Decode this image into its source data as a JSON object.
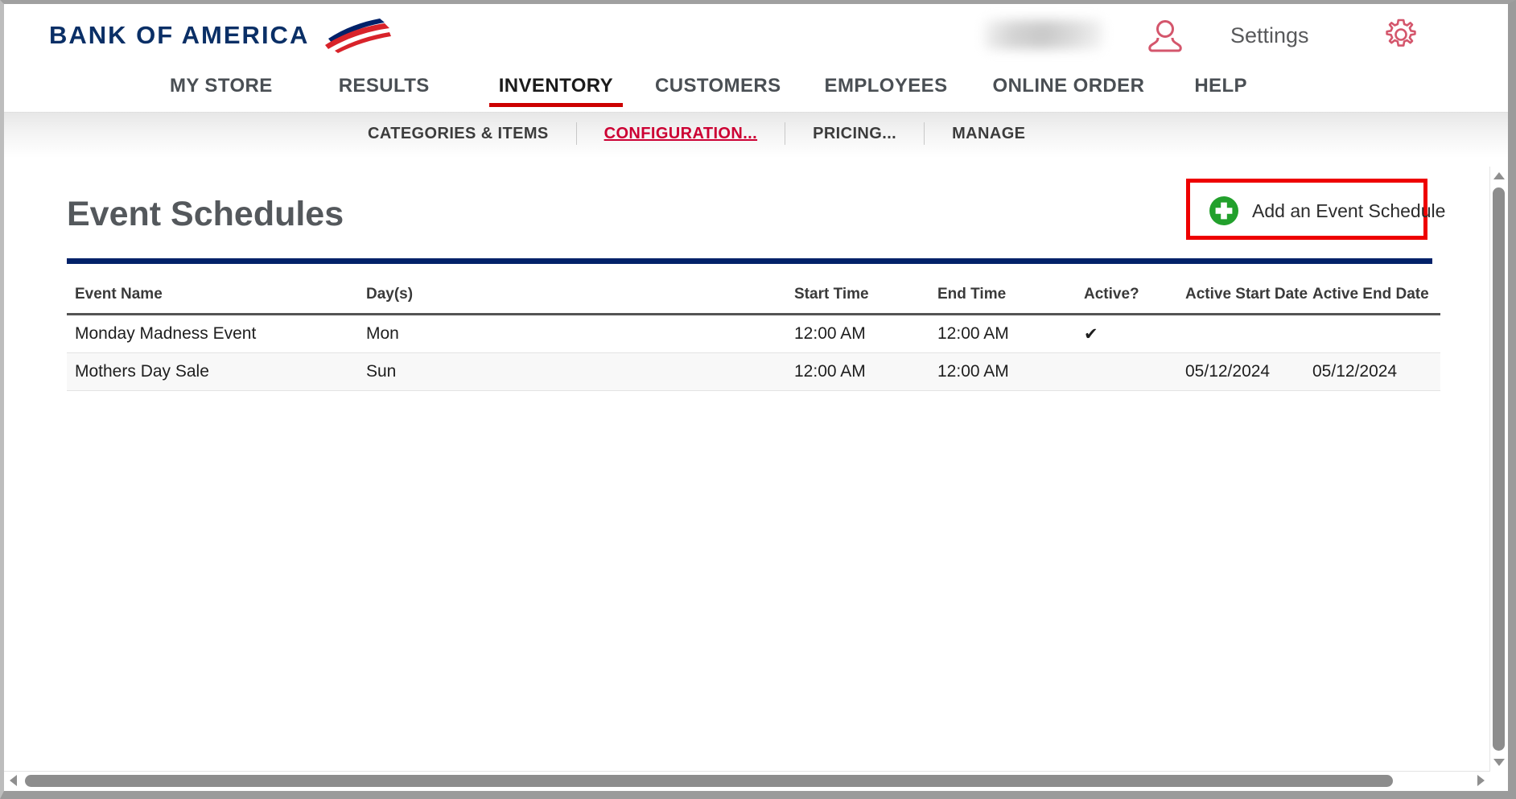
{
  "brand": {
    "wordmark": "BANK OF AMERICA",
    "logo_navy": "#0a2f66",
    "logo_red": "#d8232a"
  },
  "header": {
    "username_masked": "",
    "person_icon": "person-icon",
    "settings_label": "Settings",
    "gear_icon": "gear-icon",
    "icon_color": "#d4566c"
  },
  "primary_nav": {
    "active_color": "#cc0000",
    "items": [
      {
        "label": "MY STORE",
        "active": false
      },
      {
        "label": "RESULTS",
        "active": false
      },
      {
        "label": "INVENTORY",
        "active": true
      },
      {
        "label": "CUSTOMERS",
        "active": false
      },
      {
        "label": "EMPLOYEES",
        "active": false
      },
      {
        "label": "ONLINE ORDER",
        "active": false
      },
      {
        "label": "HELP",
        "active": false
      }
    ]
  },
  "secondary_nav": {
    "active_color": "#cc0033",
    "items": [
      {
        "label": "CATEGORIES & ITEMS",
        "active": false
      },
      {
        "label": "CONFIGURATION...",
        "active": true
      },
      {
        "label": "PRICING...",
        "active": false
      },
      {
        "label": "MANAGE",
        "active": false
      }
    ]
  },
  "main": {
    "page_title": "Event Schedules",
    "add_button": {
      "label": "Add an Event Schedule",
      "icon": "plus-circle-icon",
      "icon_color": "#22a02c",
      "highlight_color": "#ee0000"
    },
    "divider_color": "#012169",
    "table": {
      "columns": [
        "Event Name",
        "Day(s)",
        "Start Time",
        "End Time",
        "Active?",
        "Active Start Date",
        "Active End Date"
      ],
      "rows": [
        {
          "event_name": "Monday Madness Event",
          "days": "Mon",
          "start_time": "12:00 AM",
          "end_time": "12:00 AM",
          "active": "✔",
          "active_start_date": "",
          "active_end_date": ""
        },
        {
          "event_name": "Mothers Day Sale",
          "days": "Sun",
          "start_time": "12:00 AM",
          "end_time": "12:00 AM",
          "active": "",
          "active_start_date": "05/12/2024",
          "active_end_date": "05/12/2024"
        }
      ]
    }
  }
}
